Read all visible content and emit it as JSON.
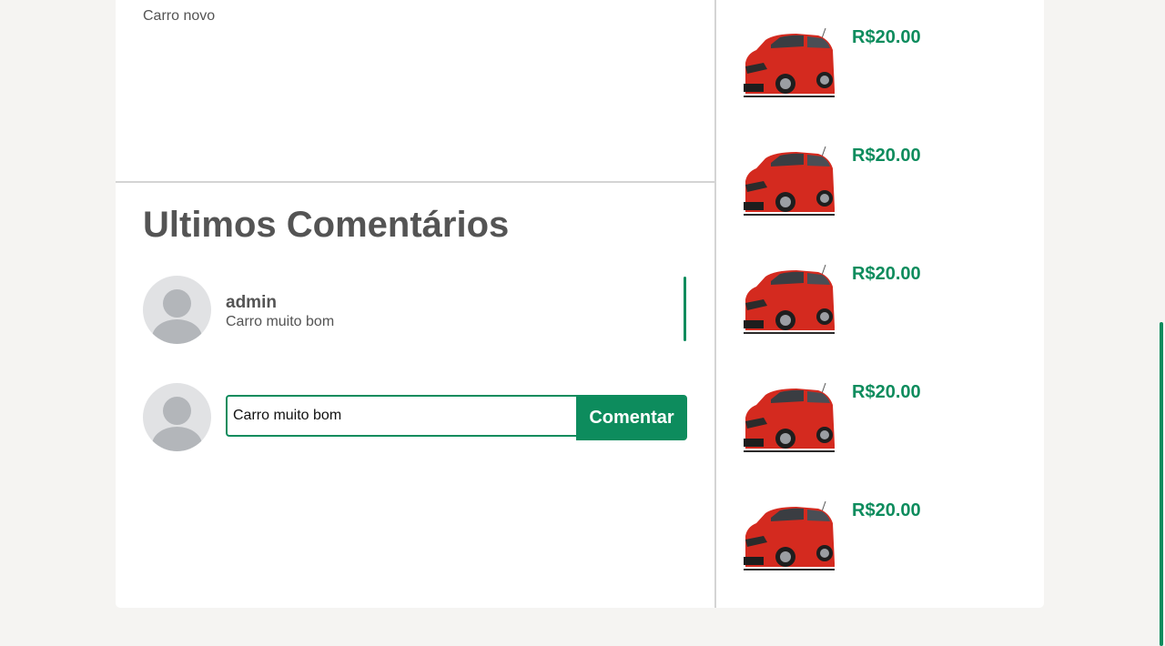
{
  "product": {
    "description": "Carro novo"
  },
  "comments": {
    "title": "Ultimos Comentários",
    "items": [
      {
        "author": "admin",
        "text": "Carro muito bom"
      }
    ],
    "compose": {
      "value": "Carro muito bom",
      "button_label": "Comentar"
    }
  },
  "related_products": [
    {
      "price": "R$20.00",
      "image": "red-hatchback-car"
    },
    {
      "price": "R$20.00",
      "image": "red-hatchback-car"
    },
    {
      "price": "R$20.00",
      "image": "red-hatchback-car"
    },
    {
      "price": "R$20.00",
      "image": "red-hatchback-car"
    },
    {
      "price": "R$20.00",
      "image": "red-hatchback-car"
    }
  ],
  "colors": {
    "accent": "#0d8c5d",
    "car_body": "#d42a1f",
    "text": "#545454",
    "background": "#f5f4f2"
  }
}
